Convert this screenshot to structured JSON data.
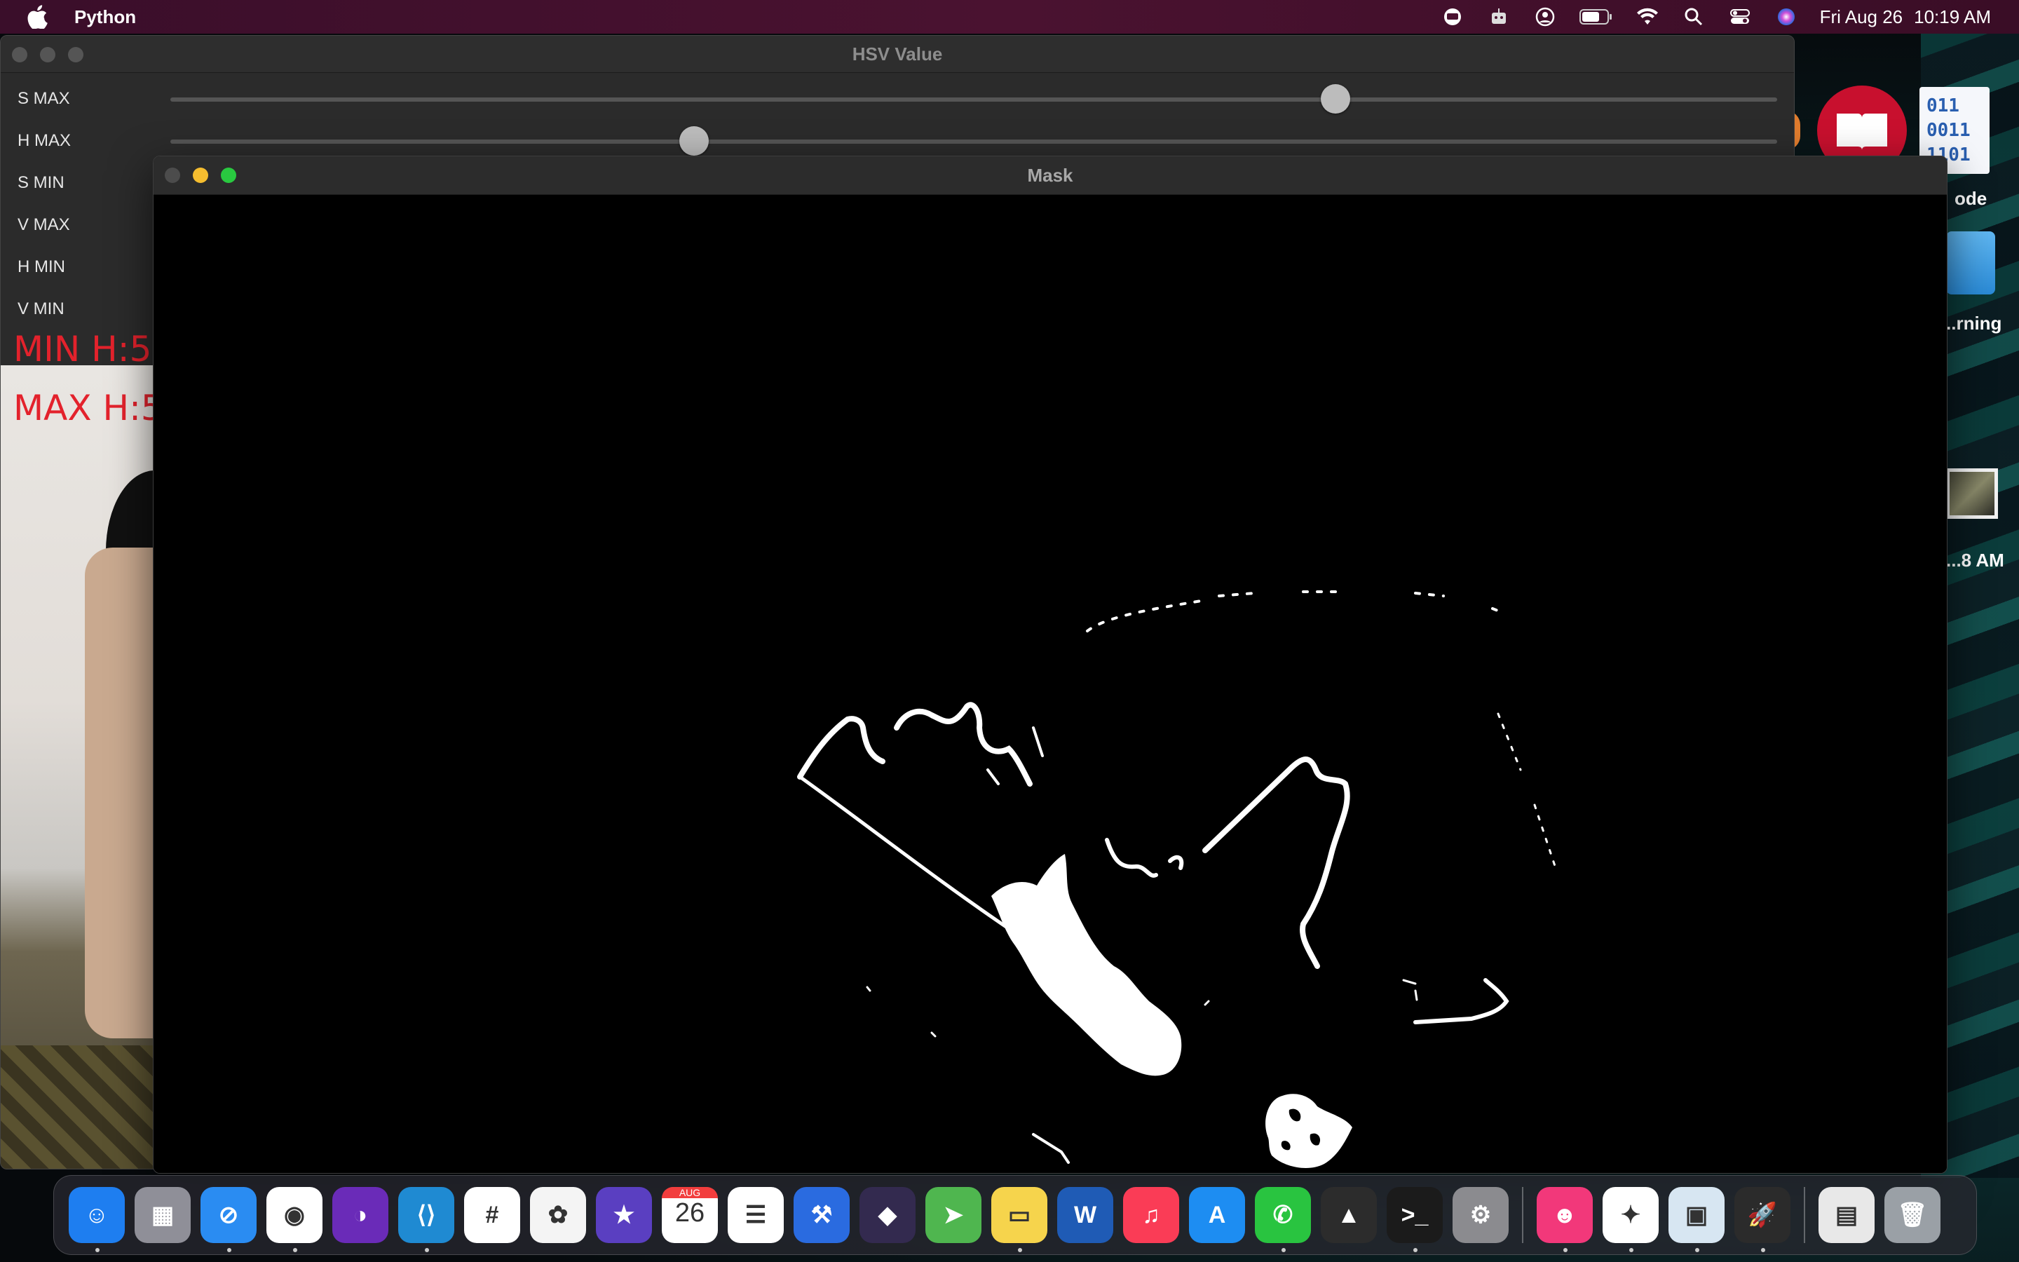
{
  "menubar": {
    "app_name": "Python",
    "date": "Fri Aug 26",
    "time": "10:19 AM",
    "status_icons": [
      "screen-share-icon",
      "robot-icon",
      "user-circle-icon",
      "battery-icon",
      "wifi-icon",
      "spotlight-search-icon",
      "control-center-icon",
      "siri-icon"
    ]
  },
  "hsv_window": {
    "title": "HSV Value",
    "sliders": [
      {
        "label": "S MAX",
        "level": 0.725,
        "has_track": true
      },
      {
        "label": "H MAX",
        "level": 0.326,
        "has_track": true
      },
      {
        "label": "S MIN",
        "has_track": false
      },
      {
        "label": "V MAX",
        "has_track": false
      },
      {
        "label": "H MIN",
        "has_track": false
      },
      {
        "label": "V MIN",
        "has_track": false
      }
    ],
    "overlay_min": "MIN  H:5",
    "overlay_max": "MAX  H:5"
  },
  "mask_window": {
    "title": "Mask"
  },
  "desktop": {
    "binary_icon_text": [
      "011",
      "0011",
      "1101"
    ],
    "label_code": "ode",
    "label_learning": "..rning",
    "label_screenshot": "...8 AM"
  },
  "dock": {
    "items": [
      {
        "name": "finder",
        "color": "#1e7ef0",
        "glyph": "☺",
        "running": true
      },
      {
        "name": "launchpad",
        "color": "#8f8f98",
        "glyph": "▦",
        "running": false
      },
      {
        "name": "safari",
        "color": "#2a8cf2",
        "glyph": "⊘",
        "running": true
      },
      {
        "name": "chrome",
        "color": "#ffffff",
        "glyph": "◉",
        "running": true
      },
      {
        "name": "tor-browser",
        "color": "#6a2bb8",
        "glyph": "◑",
        "running": false
      },
      {
        "name": "vscode",
        "color": "#1f8ad2",
        "glyph": "⟨⟩",
        "running": true
      },
      {
        "name": "slack",
        "color": "#ffffff",
        "glyph": "#",
        "running": false
      },
      {
        "name": "photos",
        "color": "#f4f4f4",
        "glyph": "✿",
        "running": false
      },
      {
        "name": "imovie",
        "color": "#5a3fc1",
        "glyph": "★",
        "running": false
      },
      {
        "name": "calendar",
        "color": "#ffffff",
        "glyph": "26",
        "running": false
      },
      {
        "name": "reminders",
        "color": "#ffffff",
        "glyph": "☰",
        "running": false
      },
      {
        "name": "xcode-instruments",
        "color": "#2a6be0",
        "glyph": "⚒",
        "running": false
      },
      {
        "name": "obsidian",
        "color": "#332a4f",
        "glyph": "◆",
        "running": false
      },
      {
        "name": "maps",
        "color": "#4fb64f",
        "glyph": "➤",
        "running": false
      },
      {
        "name": "notes",
        "color": "#f6d44c",
        "glyph": "▭",
        "running": true
      },
      {
        "name": "word",
        "color": "#1f5bb5",
        "glyph": "W",
        "running": false
      },
      {
        "name": "music",
        "color": "#fa3c56",
        "glyph": "♫",
        "running": false
      },
      {
        "name": "app-store",
        "color": "#1d8df2",
        "glyph": "A",
        "running": false
      },
      {
        "name": "whatsapp",
        "color": "#29c440",
        "glyph": "✆",
        "running": true
      },
      {
        "name": "vlc",
        "color": "#2c2c2c",
        "glyph": "▲",
        "running": false
      },
      {
        "name": "terminal",
        "color": "#1b1b1b",
        "glyph": ">_",
        "running": true
      },
      {
        "name": "system-preferences",
        "color": "#8b8b8f",
        "glyph": "⚙",
        "running": false
      }
    ],
    "items_right": [
      {
        "name": "robot-app",
        "color": "#f2387a",
        "glyph": "☻",
        "running": true
      },
      {
        "name": "messenger",
        "color": "#ffffff",
        "glyph": "✦",
        "running": true
      },
      {
        "name": "preview",
        "color": "#d7e6f2",
        "glyph": "▣",
        "running": true
      },
      {
        "name": "python-launcher",
        "color": "#2b2b2b",
        "glyph": "🚀",
        "running": true
      }
    ],
    "items_trailing": [
      {
        "name": "documents-stack",
        "color": "#e8e8e8",
        "glyph": "▤",
        "running": false
      },
      {
        "name": "trash",
        "color": "#9aa0a6",
        "glyph": "🗑",
        "running": false
      }
    ],
    "calendar_month": "AUG",
    "calendar_day": "26"
  }
}
